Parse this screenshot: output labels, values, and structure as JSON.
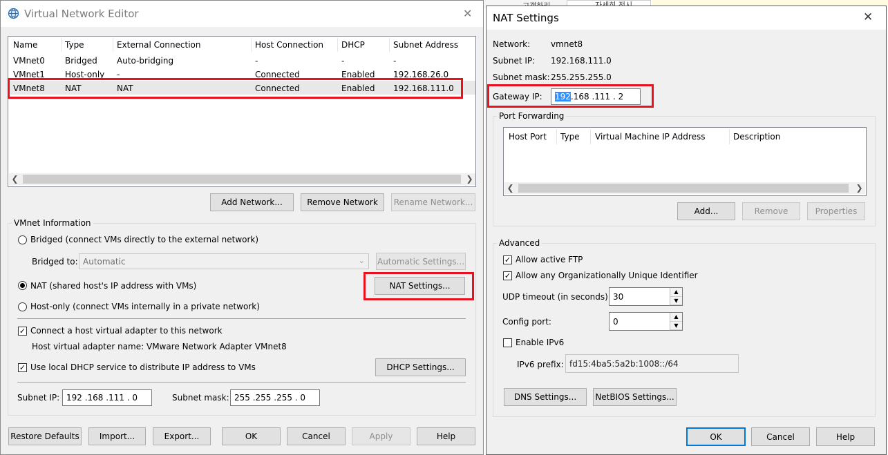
{
  "vne": {
    "title": "Virtual Network Editor",
    "columns": [
      "Name",
      "Type",
      "External Connection",
      "Host Connection",
      "DHCP",
      "Subnet Address"
    ],
    "rows": [
      [
        "VMnet0",
        "Bridged",
        "Auto-bridging",
        "-",
        "-",
        "-"
      ],
      [
        "VMnet1",
        "Host-only",
        "-",
        "Connected",
        "Enabled",
        "192.168.26.0"
      ],
      [
        "VMnet8",
        "NAT",
        "NAT",
        "Connected",
        "Enabled",
        "192.168.111.0"
      ]
    ],
    "buttons": {
      "add_network": "Add Network...",
      "remove_network": "Remove Network",
      "rename_network": "Rename Network...",
      "automatic_settings": "Automatic Settings...",
      "nat_settings": "NAT Settings...",
      "dhcp_settings": "DHCP Settings...",
      "restore_defaults": "Restore Defaults",
      "import": "Import...",
      "export": "Export...",
      "ok": "OK",
      "cancel": "Cancel",
      "apply": "Apply",
      "help": "Help"
    },
    "vmnet_info": {
      "group_label": "VMnet Information",
      "bridged_label": "Bridged (connect VMs directly to the external network)",
      "bridged_to_label": "Bridged to:",
      "bridged_to_value": "Automatic",
      "nat_label": "NAT (shared host's IP address with VMs)",
      "hostonly_label": "Host-only (connect VMs internally in a private network)",
      "connect_adapter_label": "Connect a host virtual adapter to this network",
      "adapter_name_text": "Host virtual adapter name: VMware Network Adapter VMnet8",
      "dhcp_label": "Use local DHCP service to distribute IP address to VMs",
      "subnet_ip_label": "Subnet IP:",
      "subnet_ip_value": "192 .168 .111 .  0",
      "subnet_mask_label": "Subnet mask:",
      "subnet_mask_value": "255 .255 .255 .  0"
    }
  },
  "nat": {
    "title": "NAT Settings",
    "network_label": "Network:",
    "network_value": "vmnet8",
    "subnet_ip_label": "Subnet IP:",
    "subnet_ip_value": "192.168.111.0",
    "subnet_mask_label": "Subnet mask:",
    "subnet_mask_value": "255.255.255.0",
    "gateway_label": "Gateway IP:",
    "gateway_first": "192",
    "gateway_rest": " .168 .111 .  2",
    "port_forwarding": {
      "group_label": "Port Forwarding",
      "columns": [
        "Host Port",
        "Type",
        "Virtual Machine IP Address",
        "Description"
      ],
      "add": "Add...",
      "remove": "Remove",
      "properties": "Properties"
    },
    "advanced": {
      "group_label": "Advanced",
      "allow_ftp": "Allow active FTP",
      "allow_oui": "Allow any Organizationally Unique Identifier",
      "udp_timeout_label": "UDP timeout (in seconds):",
      "udp_timeout_value": "30",
      "config_port_label": "Config port:",
      "config_port_value": "0",
      "enable_ipv6": "Enable IPv6",
      "ipv6_prefix_label": "IPv6 prefix:",
      "ipv6_prefix_value": "fd15:4ba5:5a2b:1008::/64",
      "dns_settings": "DNS Settings...",
      "netbios_settings": "NetBIOS Settings..."
    },
    "ok": "OK",
    "cancel": "Cancel",
    "help": "Help"
  },
  "background_text": {
    "a": "고객하리",
    "b": "자세히 전시"
  },
  "colors": {
    "highlight_box": "#e8111d",
    "selection": "#3390ff",
    "accent": "#0078d7"
  }
}
